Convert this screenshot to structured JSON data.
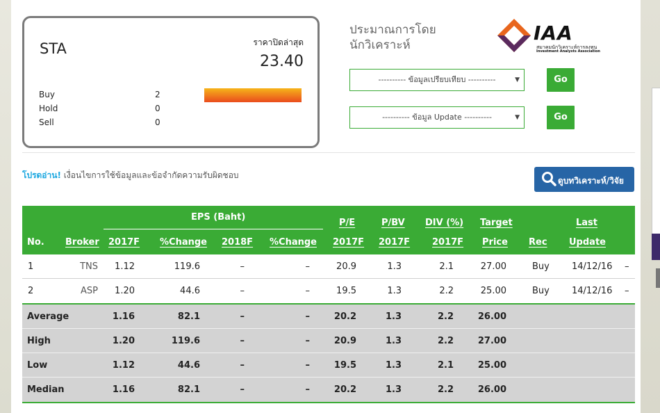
{
  "summary": {
    "symbol": "STA",
    "last_close_label": "ราคาปิดล่าสุด",
    "last_close_value": "23.40",
    "ratings": [
      {
        "label": "Buy",
        "count": "2"
      },
      {
        "label": "Hold",
        "count": "0"
      },
      {
        "label": "Sell",
        "count": "0"
      }
    ]
  },
  "estimates_title_line1": "ประมาณการโดย",
  "estimates_title_line2": "นักวิเคราะห์",
  "logo": {
    "text": "IAA",
    "sub_th": "สมาคมนักวิเคราะห์การลงทุน",
    "sub_en": "Investment Analysts Association"
  },
  "select_compare": "---------- ข้อมูลเปรียบเทียบ ----------",
  "select_update": "---------- ข้อมูล Update ----------",
  "go_label": "Go",
  "disclaimer_prefix": "โปรดอ่าน!",
  "disclaimer_text": "เงื่อนไขการใช้ข้อมูลและข้อจำกัดความรับผิดชอบ",
  "analyst_button": "ดูบทวิเคราะห์/วิจัย",
  "table": {
    "header_top": {
      "eps": "EPS (Baht)",
      "pe": "P/E",
      "pbv": "P/BV",
      "div": "DIV (%)",
      "target": "Target",
      "last": "Last"
    },
    "header_bottom": {
      "no": "No.",
      "broker": "Broker",
      "eps2017": "2017F",
      "chg1": "%Change",
      "eps2018": "2018F",
      "chg2": "%Change",
      "pe": "2017F",
      "pbv": "2017F",
      "div": "2017F",
      "price": "Price",
      "rec": "Rec",
      "update": "Update"
    },
    "rows": [
      {
        "no": "1",
        "broker": "TNS",
        "eps2017": "1.12",
        "chg1": "119.6",
        "eps2018": "–",
        "chg2": "–",
        "pe": "20.9",
        "pbv": "1.3",
        "div": "2.1",
        "target": "27.00",
        "rec": "Buy",
        "update": "14/12/16",
        "extra": "–"
      },
      {
        "no": "2",
        "broker": "ASP",
        "eps2017": "1.20",
        "chg1": "44.6",
        "eps2018": "–",
        "chg2": "–",
        "pe": "19.5",
        "pbv": "1.3",
        "div": "2.2",
        "target": "25.00",
        "rec": "Buy",
        "update": "14/12/16",
        "extra": "–"
      }
    ],
    "stats": [
      {
        "label": "Average",
        "eps2017": "1.16",
        "chg1": "82.1",
        "eps2018": "–",
        "chg2": "–",
        "pe": "20.2",
        "pbv": "1.3",
        "div": "2.2",
        "target": "26.00"
      },
      {
        "label": "High",
        "eps2017": "1.20",
        "chg1": "119.6",
        "eps2018": "–",
        "chg2": "–",
        "pe": "20.9",
        "pbv": "1.3",
        "div": "2.2",
        "target": "27.00"
      },
      {
        "label": "Low",
        "eps2017": "1.12",
        "chg1": "44.6",
        "eps2018": "–",
        "chg2": "–",
        "pe": "19.5",
        "pbv": "1.3",
        "div": "2.1",
        "target": "25.00"
      },
      {
        "label": "Median",
        "eps2017": "1.16",
        "chg1": "82.1",
        "eps2018": "–",
        "chg2": "–",
        "pe": "20.2",
        "pbv": "1.3",
        "div": "2.2",
        "target": "26.00"
      }
    ]
  },
  "colors": {
    "accent_green": "#3aab35",
    "button_blue": "#2765a6",
    "link_cyan": "#1ba7e0",
    "logo_orange": "#e8661d",
    "logo_purple": "#5a2a5e"
  }
}
